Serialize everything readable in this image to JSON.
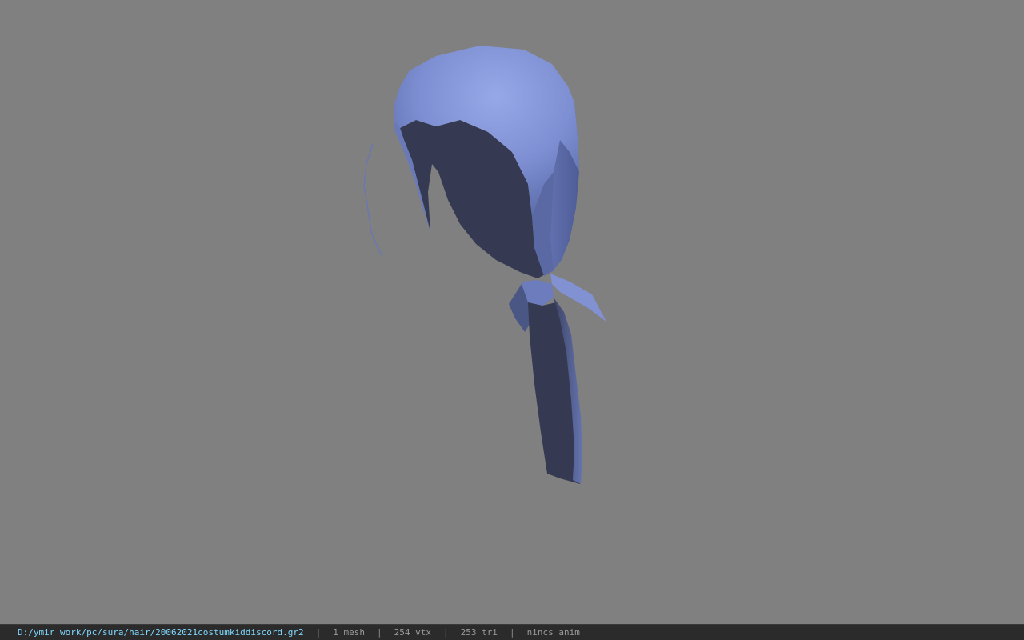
{
  "status_bar": {
    "file_path": "D:/ymir work/pc/sura/hair/20062021costumkiddiscord.gr2",
    "mesh_count": "1 mesh",
    "vertex_count": "254 vtx",
    "triangle_count": "253 tri",
    "anim_status": "nincs anim",
    "separator": "|"
  },
  "colors": {
    "background": "#808080",
    "model_light": "#8fa0e0",
    "model_mid": "#6878b8",
    "model_dark": "#353a52",
    "status_bar_bg": "#2b2b2b",
    "path_color": "#7fd8ff"
  },
  "model": {
    "subject": "hair-mesh-preview"
  }
}
